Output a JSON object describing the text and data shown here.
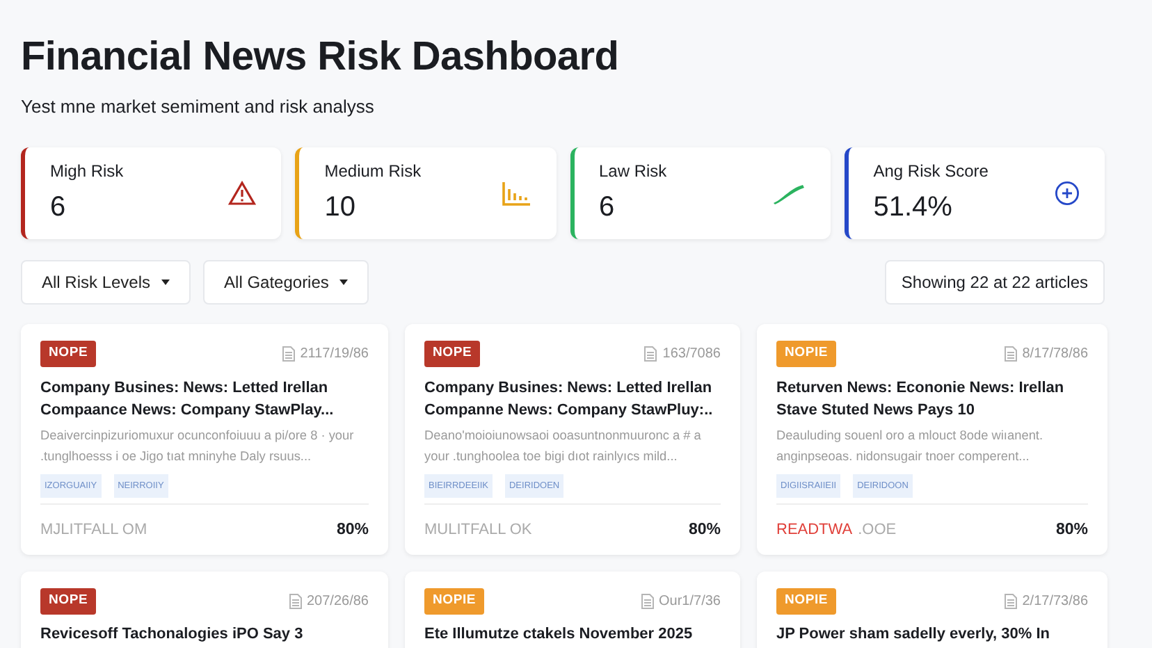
{
  "header": {
    "title": "Financial News Risk Dashboard",
    "subtitle": "Yest mne market semiment and risk analyss"
  },
  "stats": [
    {
      "label": "Migh Risk",
      "value": "6",
      "color": "#b3261e"
    },
    {
      "label": "Medium Risk",
      "value": "10",
      "color": "#e8a317"
    },
    {
      "label": "Law Risk",
      "value": "6",
      "color": "#2bb35f"
    },
    {
      "label": "Ang Risk Score",
      "value": "51.4%",
      "color": "#2548c8"
    }
  ],
  "filters": [
    {
      "label": "All Risk Levels"
    },
    {
      "label": "All Gategories"
    }
  ],
  "summary": "Showing 22 at 22 articles",
  "articles": [
    {
      "badge": "NOPE",
      "color": "#b8382a",
      "date": "2117/19/86",
      "title": "Company Busines: News: Letted Irellan Compaance News: Company StawPlay...",
      "description": "Deaivercinpizuriomuxur ocunconfoiuuu a pi/ore 8 · your .tunglhoesss i oe Jigo tıat mninyhe Daly rsuus...",
      "tags": [
        "IZORGUAIIY",
        "NEIRROIIY"
      ],
      "source": "MJLITFALL OM",
      "score": "80%"
    },
    {
      "badge": "NOPE",
      "color": "#b8382a",
      "date": "163/7086",
      "title": "Company Busines: News: Letted Irellan Companne News: Company StawPluy:..",
      "description": "Deano'moioiunowsaoi ooasuntnonmuuronc a # a your .tunghoolea toe bigi dıot rainlyıcs mild...",
      "tags": [
        "BIEIRRDEEIIK",
        "DEIRIDOEN"
      ],
      "source": "MULITFALL OK",
      "score": "80%"
    },
    {
      "badge": "NOPIE",
      "color": "#ef9a2c",
      "date": "8/17/78/86",
      "title": "Returven News: Econonie News: Irellan Stave Stuted News Pays 10",
      "description": "Deauluding souenl oro a mlouct 8ode wiıanent. anginpseoas. nidonsugair tnoer comperent...",
      "tags": [
        "DIGIISRAIIEII",
        "DEIRIDOON"
      ],
      "source_flag": "READTWA",
      "source": ".OOE",
      "score": "80%"
    },
    {
      "badge": "NOPE",
      "color": "#b8382a",
      "date": "207/26/86",
      "title": "Revicesoff Tachonalogies iPO Say 3"
    },
    {
      "badge": "NOPIE",
      "color": "#ef9a2c",
      "date": "Our1/7/36",
      "title": "Ete Illumutze ctakels November 2025"
    },
    {
      "badge": "NOPIE",
      "color": "#ef9a2c",
      "date": "2/17/73/86",
      "title": "JP Power sham sadelly everly, 30% In"
    }
  ]
}
